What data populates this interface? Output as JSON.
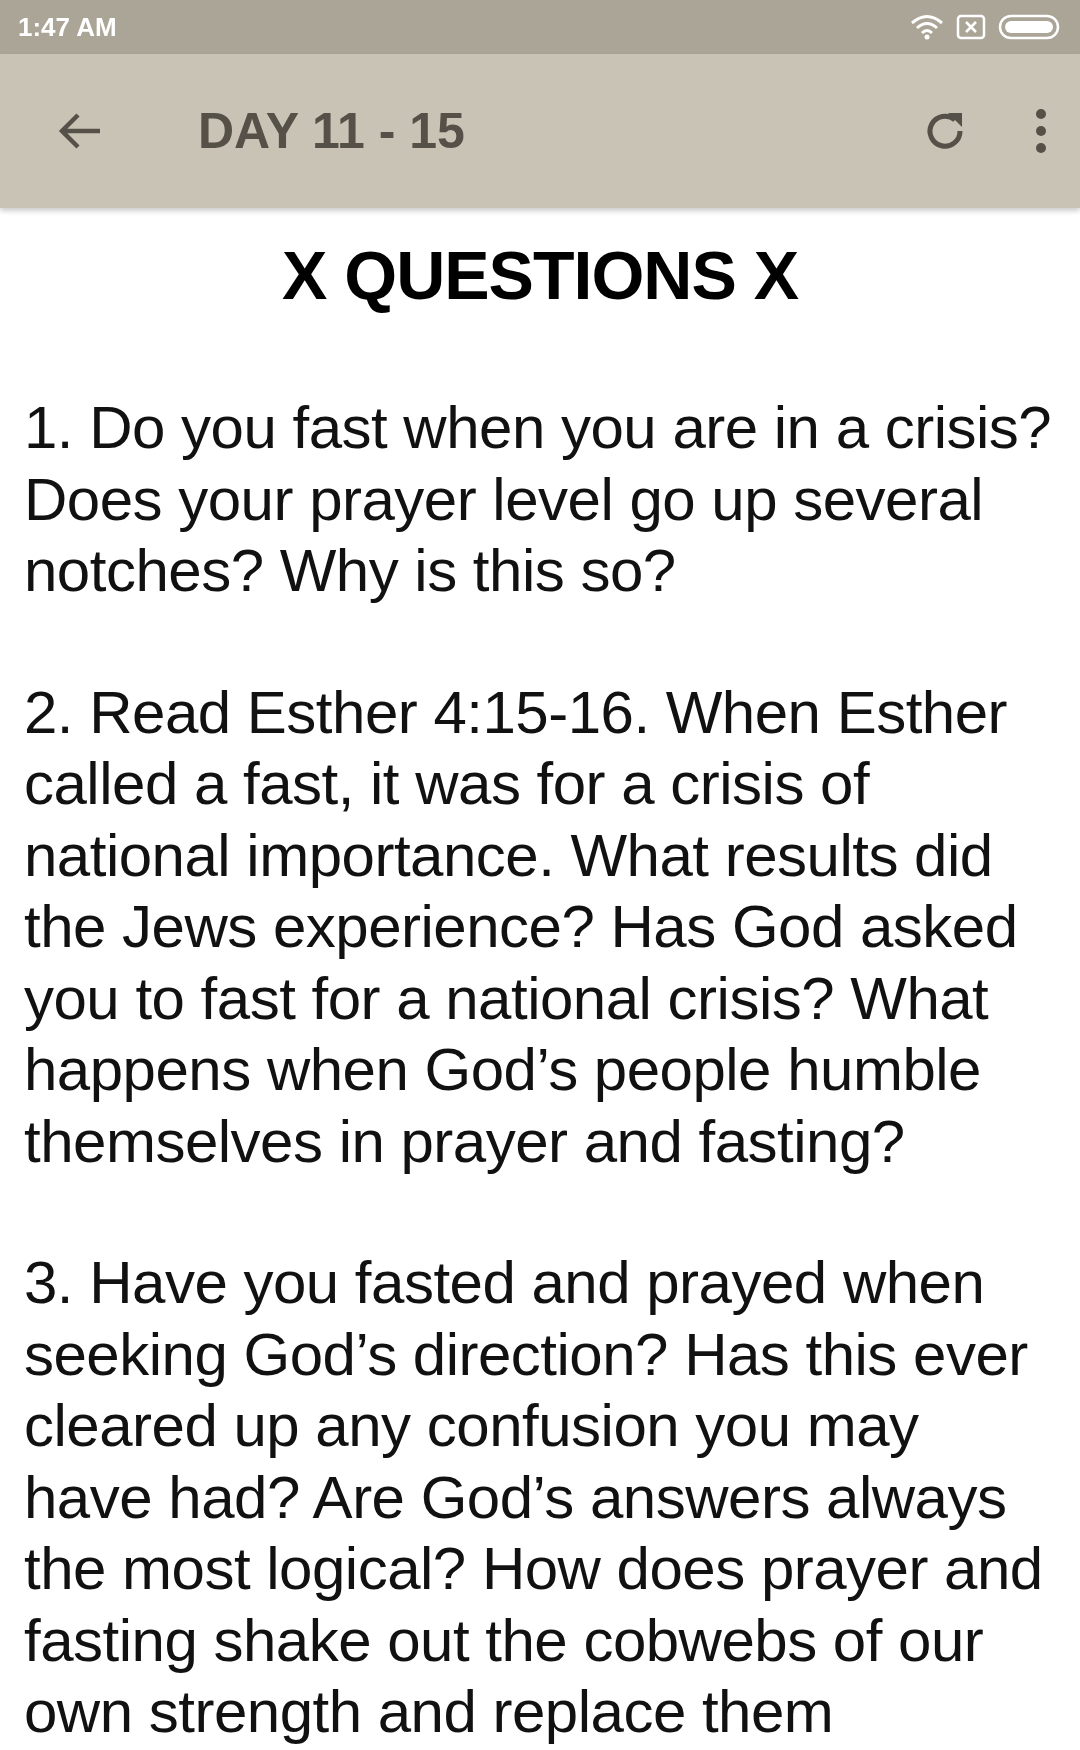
{
  "status_bar": {
    "time": "1:47 AM"
  },
  "app_bar": {
    "title": "DAY 11 - 15"
  },
  "heading": "X QUESTIONS X",
  "questions": [
    "1. Do you fast when you are in a crisis? Does your prayer level go up several notches? Why is this so?",
    "2. Read Esther 4:15-16. When Esther called a fast, it was for a crisis of national importance. What results did the Jews experience? Has God asked you to fast for a national crisis? What happens when God’s people humble themselves in prayer and fasting?",
    "3. Have you fasted and prayed when seeking God’s direction? Has this ever cleared up any confusion you may have had? Are God’s answers always the most logical? How does prayer and fasting shake out the cobwebs of our own strength and replace them"
  ]
}
